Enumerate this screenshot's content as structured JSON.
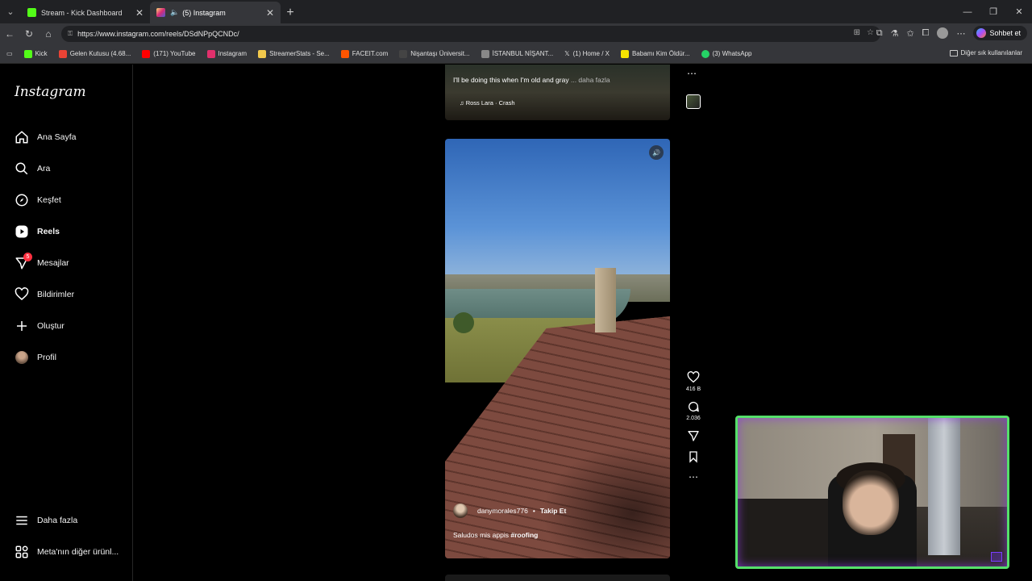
{
  "browser": {
    "tabs": [
      {
        "title": "Stream - Kick Dashboard",
        "color": "#53fc18"
      },
      {
        "title": "(5) Instagram",
        "color": "#e1306c"
      }
    ],
    "url": "https://www.instagram.com/reels/DSdNPpQCNDc/",
    "copilot_label": "Sohbet et",
    "bookmarks": [
      {
        "label": "Kick",
        "color": "#53fc18"
      },
      {
        "label": "Gelen Kutusu (4.68...",
        "color": "#ea4335"
      },
      {
        "label": "(171) YouTube",
        "color": "#ff0000"
      },
      {
        "label": "Instagram",
        "color": "#e1306c"
      },
      {
        "label": "StreamerStats - Se...",
        "color": "#f2c94c"
      },
      {
        "label": "FACEIT.com",
        "color": "#ff5500"
      },
      {
        "label": "Nişantaşı Üniversit...",
        "color": "#444444"
      },
      {
        "label": "İSTANBUL NİŞANT...",
        "color": "#888888"
      },
      {
        "label": "(1) Home / X",
        "color": "#ffffff"
      },
      {
        "label": "Babamı Kim Öldür...",
        "color": "#f5e300"
      },
      {
        "label": "(3) WhatsApp",
        "color": "#25d366"
      }
    ],
    "other_bookmarks": "Diğer sık kullanılanlar"
  },
  "instagram": {
    "logo": "Instagram",
    "nav": [
      {
        "label": "Ana Sayfa",
        "icon": "home-icon"
      },
      {
        "label": "Ara",
        "icon": "search-icon"
      },
      {
        "label": "Keşfet",
        "icon": "compass-icon"
      },
      {
        "label": "Reels",
        "icon": "reels-icon"
      },
      {
        "label": "Mesajlar",
        "icon": "messenger-icon",
        "badge": "5"
      },
      {
        "label": "Bildirimler",
        "icon": "heart-icon"
      },
      {
        "label": "Oluştur",
        "icon": "plus-icon"
      },
      {
        "label": "Profil",
        "icon": "avatar"
      }
    ],
    "more": "Daha fazla",
    "meta": "Meta'nın diğer ürünl...",
    "prev_reel": {
      "caption": "I'll be doing this when I'm old and gray",
      "more": "... daha fazla",
      "music": "Ross Lara · Crash"
    },
    "reel": {
      "username": "danymorales776",
      "follow": "Takip Et",
      "caption": "Saludos mis appis",
      "hashtag": "#roofing",
      "likes": "416 B",
      "comments": "2.036"
    }
  }
}
